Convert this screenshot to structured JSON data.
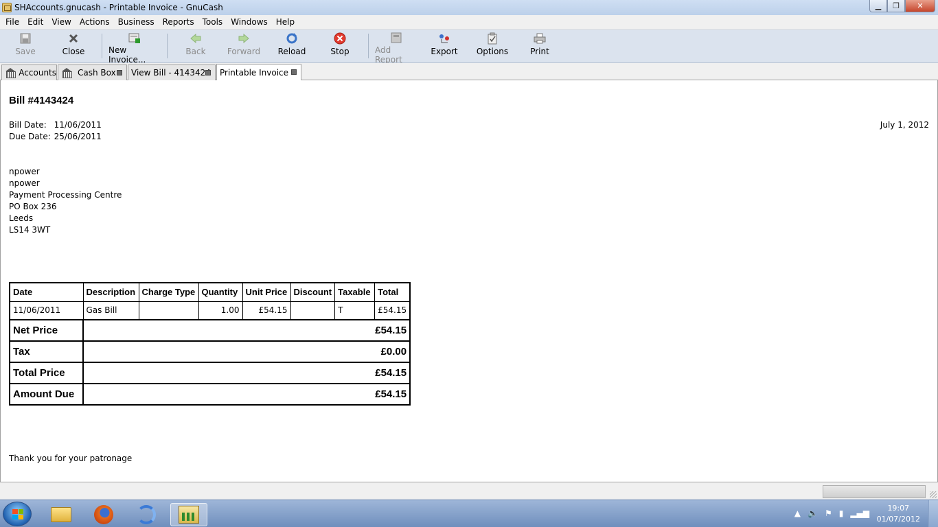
{
  "window": {
    "title": "SHAccounts.gnucash - Printable Invoice - GnuCash",
    "controls": {
      "minimize": "▁",
      "maximize": "❐",
      "close": "✕"
    }
  },
  "menu": [
    {
      "label": "File"
    },
    {
      "label": "Edit"
    },
    {
      "label": "View"
    },
    {
      "label": "Actions"
    },
    {
      "label": "Business"
    },
    {
      "label": "Reports"
    },
    {
      "label": "Tools"
    },
    {
      "label": "Windows"
    },
    {
      "label": "Help"
    }
  ],
  "toolbar": {
    "save": {
      "label": "Save",
      "icon": "save-icon"
    },
    "close": {
      "label": "Close",
      "icon": "close-icon"
    },
    "new_invoice": {
      "label": "New Invoice...",
      "icon": "new-invoice-icon"
    },
    "back": {
      "label": "Back",
      "icon": "back-arrow-icon"
    },
    "forward": {
      "label": "Forward",
      "icon": "forward-arrow-icon"
    },
    "reload": {
      "label": "Reload",
      "icon": "reload-icon"
    },
    "stop": {
      "label": "Stop",
      "icon": "stop-icon"
    },
    "add_report": {
      "label": "Add Report",
      "icon": "add-report-icon"
    },
    "export": {
      "label": "Export",
      "icon": "export-icon"
    },
    "options": {
      "label": "Options",
      "icon": "options-icon"
    },
    "print": {
      "label": "Print",
      "icon": "print-icon"
    }
  },
  "tabs": [
    {
      "label": "Accounts"
    },
    {
      "label": "Cash Box"
    },
    {
      "label": "View Bill - 4143424"
    },
    {
      "label": "Printable Invoice"
    }
  ],
  "invoice": {
    "title": "Bill #4143424",
    "bill_date_label": "Bill Date:",
    "bill_date": "11/06/2011",
    "due_date_label": "Due Date:",
    "due_date": "25/06/2011",
    "report_date": "July 1, 2012",
    "address": [
      "npower",
      "npower",
      "Payment Processing Centre",
      "PO Box 236",
      "Leeds",
      "LS14 3WT"
    ],
    "columns": [
      "Date",
      "Description",
      "Charge Type",
      "Quantity",
      "Unit Price",
      "Discount",
      "Taxable",
      "Total"
    ],
    "rows": [
      {
        "date": "11/06/2011",
        "description": "Gas Bill",
        "charge_type": "",
        "quantity": "1.00",
        "unit_price": "£54.15",
        "discount": "",
        "taxable": "T",
        "total": "£54.15"
      }
    ],
    "summary": {
      "net_label": "Net Price",
      "net_value": "£54.15",
      "tax_label": "Tax",
      "tax_value": "£0.00",
      "total_label": "Total Price",
      "total_value": "£54.15",
      "due_label": "Amount Due",
      "due_value": "£54.15"
    },
    "footer": "Thank you for your patronage"
  },
  "taskbar": {
    "clock_time": "19:07",
    "clock_date": "01/07/2012"
  }
}
